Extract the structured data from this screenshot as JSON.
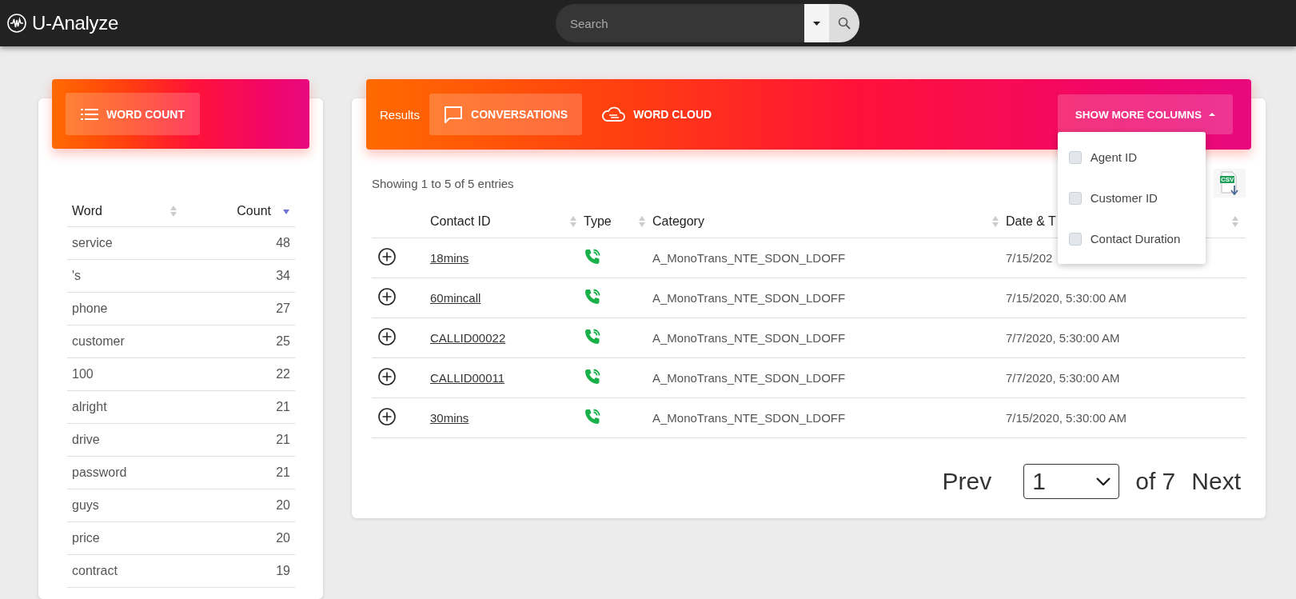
{
  "app": {
    "title": "U-Analyze"
  },
  "search": {
    "placeholder": "Search"
  },
  "word_panel": {
    "tab": {
      "label": "WORD COUNT",
      "selected": true
    },
    "columns": [
      {
        "label": "Word",
        "sorted_descending": false
      },
      {
        "label": "Count",
        "sorted_descending": true
      }
    ],
    "rows": [
      {
        "word": "service",
        "count": "48"
      },
      {
        "word": "'s",
        "count": "34"
      },
      {
        "word": "phone",
        "count": "27"
      },
      {
        "word": "customer",
        "count": "25"
      },
      {
        "word": "100",
        "count": "22"
      },
      {
        "word": "alright",
        "count": "21"
      },
      {
        "word": "drive",
        "count": "21"
      },
      {
        "word": "password",
        "count": "21"
      },
      {
        "word": "guys",
        "count": "20"
      },
      {
        "word": "price",
        "count": "20"
      },
      {
        "word": "contract",
        "count": "19"
      }
    ]
  },
  "results_panel": {
    "label": "Results",
    "tabs": [
      {
        "label": "CONVERSATIONS",
        "kind": "chat",
        "selected": true
      },
      {
        "label": "WORD CLOUD",
        "kind": "cloud",
        "selected": false
      }
    ],
    "more_columns": {
      "label": "SHOW MORE COLUMNS",
      "expanded": true,
      "options": [
        {
          "label": "Agent ID",
          "checked": false
        },
        {
          "label": "Customer ID",
          "checked": false
        },
        {
          "label": "Contact Duration",
          "checked": false
        }
      ]
    },
    "summary": "Showing 1 to 5 of 5 entries",
    "export_label": "CSV",
    "columns": [
      {
        "label": "Contact ID",
        "sorted_descending": false
      },
      {
        "label": "Type",
        "sorted_descending": false
      },
      {
        "label": "Category",
        "sorted_descending": false
      },
      {
        "label": "Date & T",
        "sorted_descending": false
      }
    ],
    "rows": [
      {
        "contact_id": "18mins",
        "category": "A_MonoTrans_NTE_SDON_LDOFF",
        "date": "7/15/202"
      },
      {
        "contact_id": "60mincall",
        "category": "A_MonoTrans_NTE_SDON_LDOFF",
        "date": "7/15/2020, 5:30:00 AM"
      },
      {
        "contact_id": "CALLID00022",
        "category": "A_MonoTrans_NTE_SDON_LDOFF",
        "date": "7/7/2020, 5:30:00 AM"
      },
      {
        "contact_id": "CALLID00011",
        "category": "A_MonoTrans_NTE_SDON_LDOFF",
        "date": "7/7/2020, 5:30:00 AM"
      },
      {
        "contact_id": "30mins",
        "category": "A_MonoTrans_NTE_SDON_LDOFF",
        "date": "7/15/2020, 5:30:00 AM"
      }
    ],
    "pagination": {
      "prev": "Prev",
      "page": "1",
      "of": "of 7",
      "next": "Next"
    }
  }
}
